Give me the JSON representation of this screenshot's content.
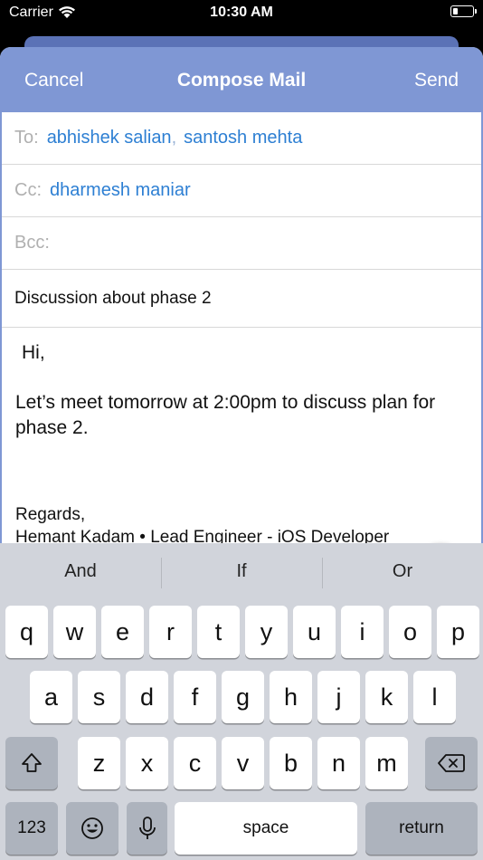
{
  "status_bar": {
    "carrier": "Carrier",
    "time": "10:30 AM"
  },
  "nav": {
    "cancel_label": "Cancel",
    "title": "Compose Mail",
    "send_label": "Send"
  },
  "fields": {
    "to_label": "To:",
    "to_recipients": [
      "abhishek salian",
      "santosh mehta"
    ],
    "recipient_separator": ",",
    "cc_label": "Cc:",
    "cc_recipients": [
      "dharmesh maniar"
    ],
    "bcc_label": "Bcc:",
    "subject": "Discussion about phase 2"
  },
  "body": {
    "greeting": "Hi,",
    "message": "Let’s meet tomorrow at 2:00pm to discuss plan for phase 2.",
    "signoff": "Regards,",
    "signature": "Hemant Kadam • Lead Engineer - iOS Developer"
  },
  "attach_button": {
    "icon": "paperclip-icon"
  },
  "keyboard": {
    "suggestions": [
      "And",
      "If",
      "Or"
    ],
    "row1": [
      "q",
      "w",
      "e",
      "r",
      "t",
      "y",
      "u",
      "i",
      "o",
      "p"
    ],
    "row2": [
      "a",
      "s",
      "d",
      "f",
      "g",
      "h",
      "j",
      "k",
      "l"
    ],
    "row3": [
      "z",
      "x",
      "c",
      "v",
      "b",
      "n",
      "m"
    ],
    "numbers_label": "123",
    "space_label": "space",
    "return_label": "return"
  },
  "colors": {
    "accent": "#7f97d4",
    "link": "#2d7fd3",
    "keyboard_bg": "#d1d4db"
  }
}
